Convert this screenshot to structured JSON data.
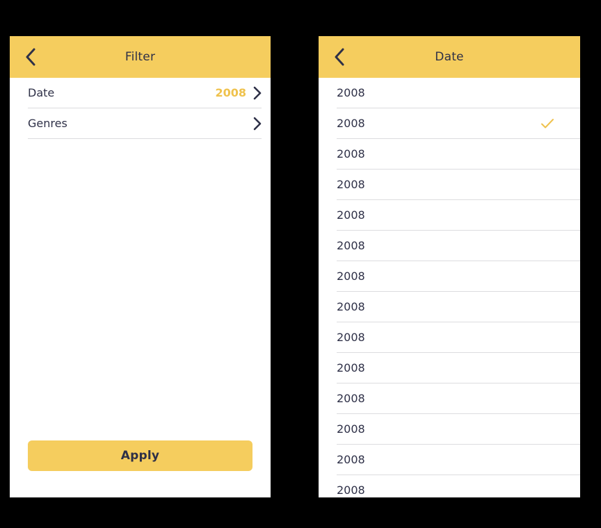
{
  "colors": {
    "accent": "#f5cd5e",
    "accent_text": "#efc24d",
    "ink": "#2e3047",
    "divider": "#dcdcdf",
    "surface": "#ffffff",
    "backdrop": "#000000"
  },
  "filter_screen": {
    "header": {
      "title": "Filter",
      "back_icon": "chevron-left-icon"
    },
    "rows": [
      {
        "label": "Date",
        "value": "2008",
        "chevron": "chevron-right-icon"
      },
      {
        "label": "Genres",
        "value": "",
        "chevron": "chevron-right-icon"
      }
    ],
    "apply_button": {
      "label": "Apply"
    }
  },
  "date_screen": {
    "header": {
      "title": "Date",
      "back_icon": "chevron-left-icon"
    },
    "selected_index": 1,
    "check_icon": "check-icon",
    "options": [
      {
        "label": "2008",
        "selected": false
      },
      {
        "label": "2008",
        "selected": true
      },
      {
        "label": "2008",
        "selected": false
      },
      {
        "label": "2008",
        "selected": false
      },
      {
        "label": "2008",
        "selected": false
      },
      {
        "label": "2008",
        "selected": false
      },
      {
        "label": "2008",
        "selected": false
      },
      {
        "label": "2008",
        "selected": false
      },
      {
        "label": "2008",
        "selected": false
      },
      {
        "label": "2008",
        "selected": false
      },
      {
        "label": "2008",
        "selected": false
      },
      {
        "label": "2008",
        "selected": false
      },
      {
        "label": "2008",
        "selected": false
      },
      {
        "label": "2008",
        "selected": false
      }
    ]
  }
}
